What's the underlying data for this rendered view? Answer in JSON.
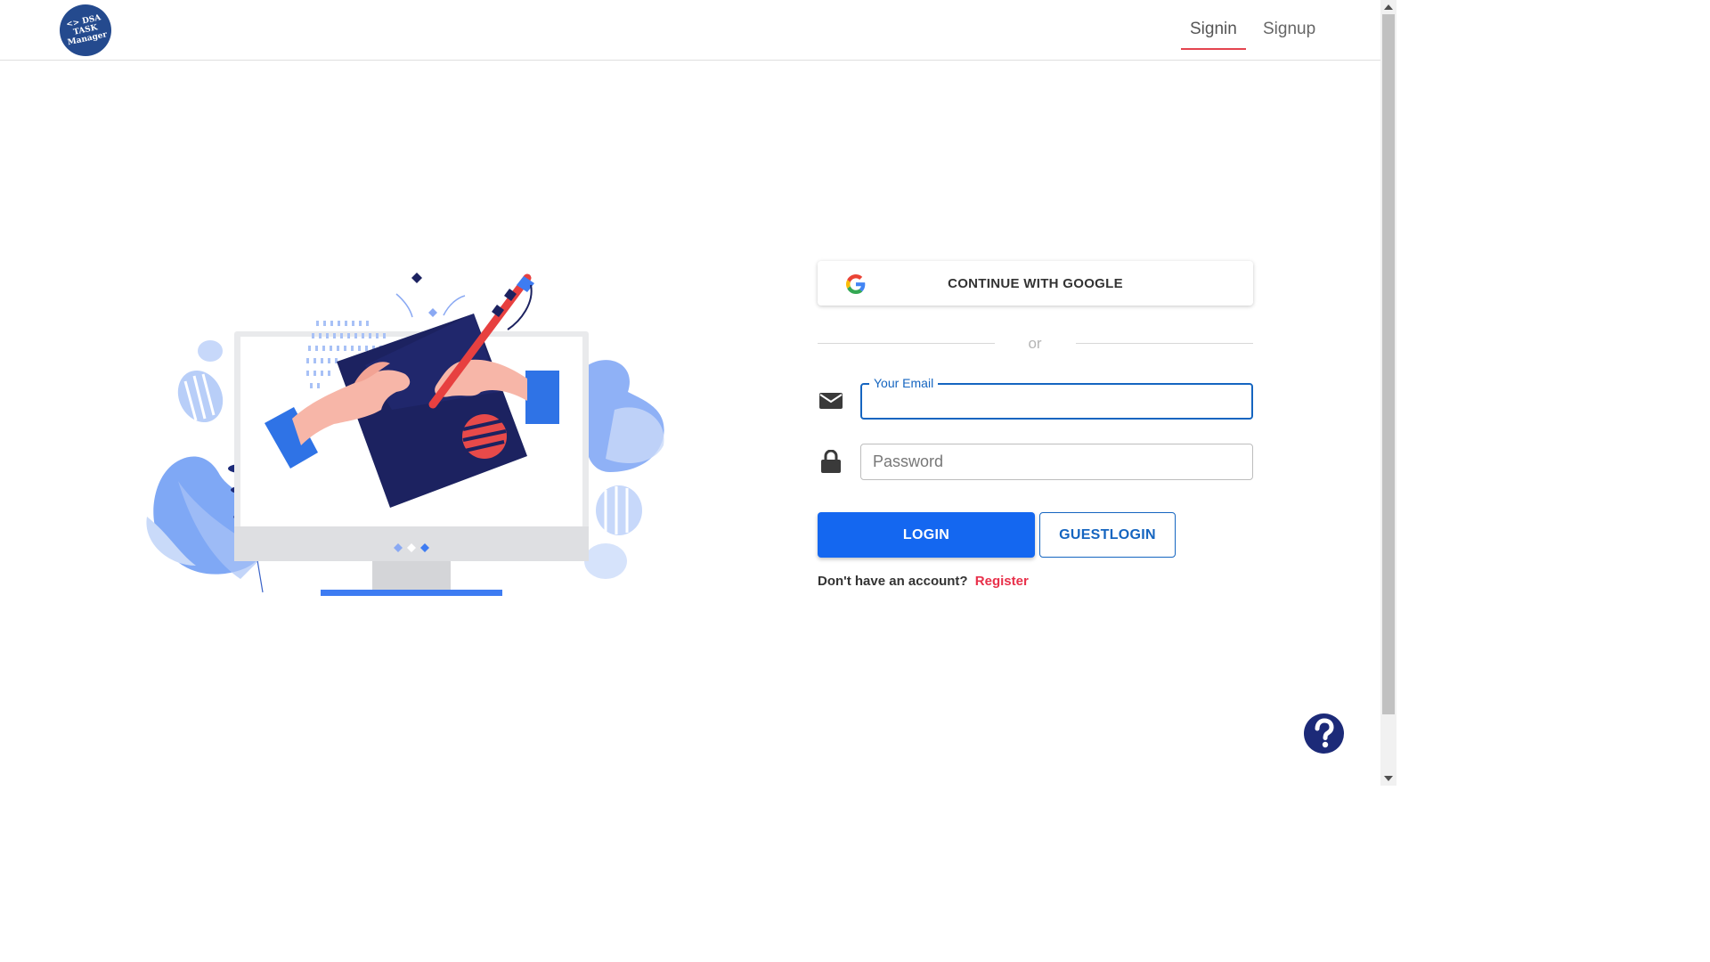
{
  "header": {
    "logo": {
      "line1": "<> DSA",
      "line2": "TASK",
      "line3": "Manager"
    },
    "tabs": [
      {
        "label": "Signin",
        "active": true
      },
      {
        "label": "Signup",
        "active": false
      }
    ]
  },
  "form": {
    "google_button": "CONTINUE WITH GOOGLE",
    "divider": "or",
    "email": {
      "label": "Your Email",
      "value": "",
      "icon": "envelope-icon"
    },
    "password": {
      "placeholder": "Password",
      "value": "",
      "icon": "lock-icon"
    },
    "login_button": "LOGIN",
    "guest_button": "GUESTLOGIN",
    "register_prompt": "Don't have an account?",
    "register_link": "Register"
  },
  "help": {
    "icon": "question-icon"
  },
  "colors": {
    "primary": "#1467f0",
    "accent_red": "#e4444f",
    "navy": "#1c2a78",
    "logo_bg": "#244a8e"
  }
}
